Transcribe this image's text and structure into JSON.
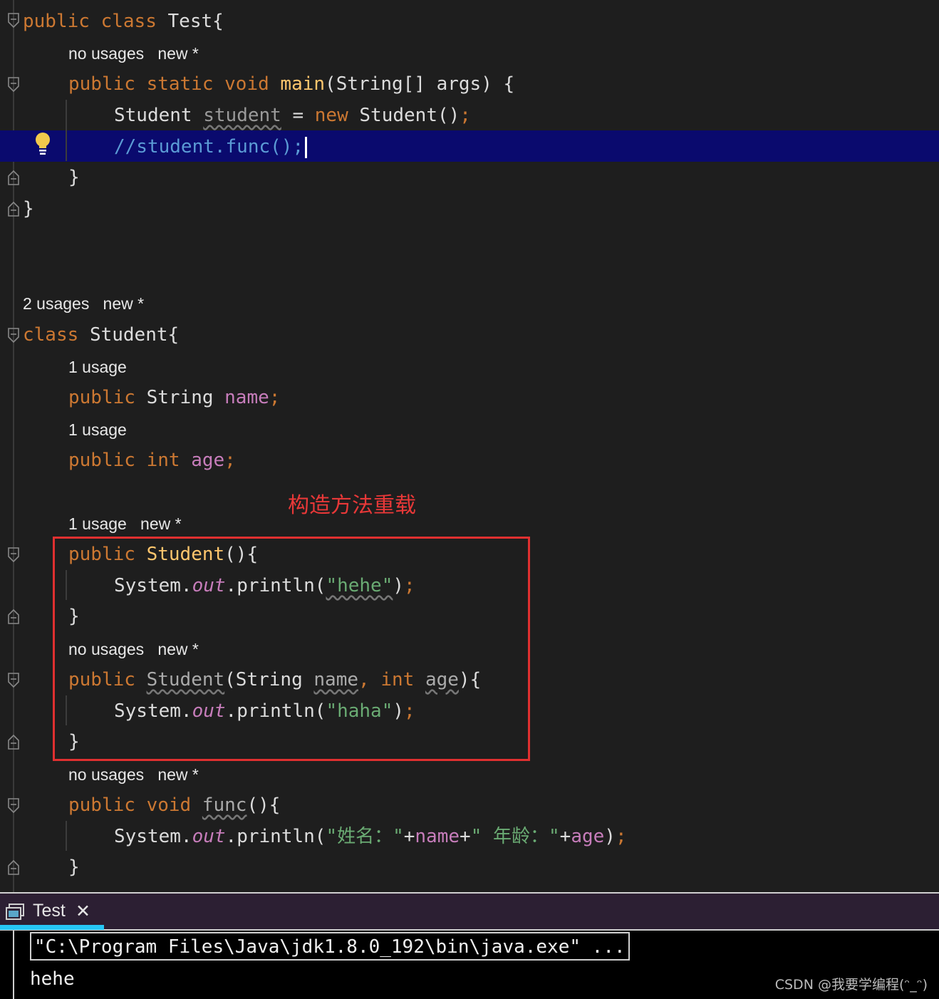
{
  "editor": {
    "test_class": {
      "kw_public": "public",
      "kw_class": "class",
      "name": "Test{",
      "main_hint_usage": "no usages",
      "main_hint_new": "new *",
      "main_sig_kw": "public static void",
      "main_name": "main",
      "main_params": "(String[] args) {",
      "stmt_type": "Student",
      "stmt_var": "student",
      "stmt_eq": " = ",
      "stmt_new": "new",
      "stmt_ctor": " Student()",
      "stmt_semi": ";",
      "comment_line": "//student.func();",
      "close_method": "}",
      "close_class": "}"
    },
    "student_class": {
      "class_hint_usage": "2 usages",
      "class_hint_new": "new *",
      "kw_class": "class",
      "name": "Student{",
      "name_hint": "1 usage",
      "name_kw": "public",
      "name_type": "String",
      "name_field": "name",
      "semi": ";",
      "age_hint": "1 usage",
      "age_kw": "public int",
      "age_field": "age",
      "ctor1_hint_usage": "1 usage",
      "ctor1_hint_new": "new *",
      "ctor1_kw": "public",
      "ctor1_name": "Student",
      "ctor1_rest": "(){",
      "ctor1_body_a": "System.",
      "ctor1_body_out": "out",
      "ctor1_body_b": ".println(",
      "ctor1_body_str": "\"hehe\"",
      "ctor1_body_c": ")",
      "ctor1_close": "}",
      "ctor2_hint_usage": "no usages",
      "ctor2_hint_new": "new *",
      "ctor2_kw": "public",
      "ctor2_name": "Student",
      "ctor2_p1": "(String ",
      "ctor2_pname": "name",
      "ctor2_comma": ",",
      "ctor2_int": "int",
      "ctor2_page": "age",
      "ctor2_end": "){",
      "ctor2_body_a": "System.",
      "ctor2_body_out": "out",
      "ctor2_body_b": ".println(",
      "ctor2_body_str": "\"haha\"",
      "ctor2_body_c": ")",
      "ctor2_close": "}",
      "func_hint_usage": "no usages",
      "func_hint_new": "new *",
      "func_kw": "public void",
      "func_name": "func",
      "func_rest": "(){",
      "func_body_a": "System.",
      "func_body_out": "out",
      "func_body_b": ".println(",
      "func_body_s1": "\"姓名：\"",
      "func_body_plus1": "+",
      "func_body_name": "name",
      "func_body_plus2": "+",
      "func_body_s2": "\" 年龄：\"",
      "func_body_plus3": "+",
      "func_body_age": "age",
      "func_body_c": ")",
      "func_close": "}"
    },
    "annotation": "构造方法重载"
  },
  "run_panel": {
    "tab_label": "Test",
    "tab_close": "✕",
    "command": "\"C:\\Program Files\\Java\\jdk1.8.0_192\\bin\\java.exe\" ...",
    "output": "hehe"
  },
  "watermark": "CSDN @我要学编程(ᵔ_ᵔ)"
}
